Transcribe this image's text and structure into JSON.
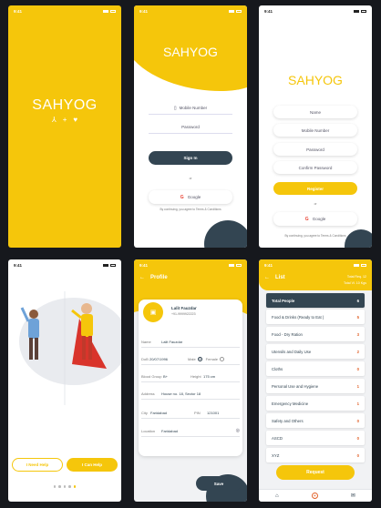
{
  "status": {
    "time": "9:41"
  },
  "splash": {
    "title": "SAHYOG"
  },
  "login": {
    "title": "SAHYOG",
    "mobile_placeholder": "Mobile Number",
    "password_placeholder": "Password",
    "signin_label": "Sign In",
    "or": "or",
    "google_label": "Google",
    "terms": "By continuing, you agree to Terms & Conditions"
  },
  "register": {
    "title": "SAHYOG",
    "name_placeholder": "Name",
    "mobile_placeholder": "Mobile Number",
    "password_placeholder": "Password",
    "confirm_placeholder": "Confirm Password",
    "register_label": "Register",
    "or": "or",
    "google_label": "Google",
    "terms": "By continuing, you agree to Terms & Conditions"
  },
  "onboard": {
    "need_help_label": "I Need Help",
    "can_help_label": "I Can Help"
  },
  "profile": {
    "header_title": "Profile",
    "name": "Lalit Fauzdar",
    "phone": "+91-9999922223",
    "fields": {
      "name_label": "Name",
      "name_value": "Lalit Fauzdar",
      "dob_label": "DoB",
      "dob_value": "20/07/1996",
      "male_label": "Male",
      "female_label": "Female",
      "blood_label": "Blood Group",
      "blood_value": "B+",
      "height_label": "Height",
      "height_value": "175 cm",
      "address_label": "Address",
      "address_value": "House no. 18, Sector 18",
      "city_label": "City",
      "city_value": "Faridabad",
      "pin_label": "PIN",
      "pin_value": "121001",
      "location_label": "Location",
      "location_value": "Faridabad"
    },
    "save_label": "Save"
  },
  "list": {
    "header_title": "List",
    "stat1": "Total Req.  12",
    "stat2": "Total Vl.  10 Kgs",
    "items": [
      {
        "label": "Total People",
        "count": "6"
      },
      {
        "label": "Food & Drinks (Ready to Eat )",
        "count": "5"
      },
      {
        "label": "Food - Dry Ration",
        "count": "3"
      },
      {
        "label": "Utensils and Daily Use",
        "count": "2"
      },
      {
        "label": "Cloths",
        "count": "0"
      },
      {
        "label": "Personal Use and Hygiene",
        "count": "1"
      },
      {
        "label": "Emergency Medicine",
        "count": "1"
      },
      {
        "label": "Safety and Others",
        "count": "0"
      },
      {
        "label": "ASCD",
        "count": "0"
      },
      {
        "label": "XYZ",
        "count": "0"
      }
    ],
    "request_label": "Request"
  },
  "colors": {
    "accent": "#f5c60b",
    "dark": "#334552",
    "orange": "#e2622a"
  }
}
